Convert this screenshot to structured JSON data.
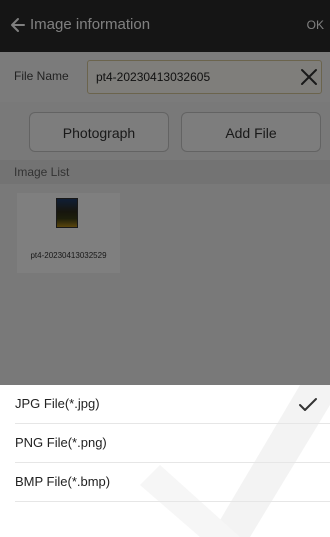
{
  "header": {
    "title": "Image information",
    "ok_label": "OK"
  },
  "file": {
    "label": "File Name",
    "value": "pt4-20230413032605"
  },
  "buttons": {
    "photograph": "Photograph",
    "add_file": "Add File"
  },
  "image_list": {
    "title": "Image List",
    "items": [
      {
        "caption": "pt4-20230413032529"
      }
    ]
  },
  "sheet": {
    "options": [
      {
        "label": "JPG File(*.jpg)",
        "selected": true
      },
      {
        "label": "PNG File(*.png)",
        "selected": false
      },
      {
        "label": "BMP File(*.bmp)",
        "selected": false
      }
    ]
  },
  "colors": {
    "header_bg": "#2b2b2b",
    "input_border": "#d7c89a"
  },
  "icons": [
    "back-arrow-icon",
    "close-icon",
    "checkmark-icon"
  ]
}
